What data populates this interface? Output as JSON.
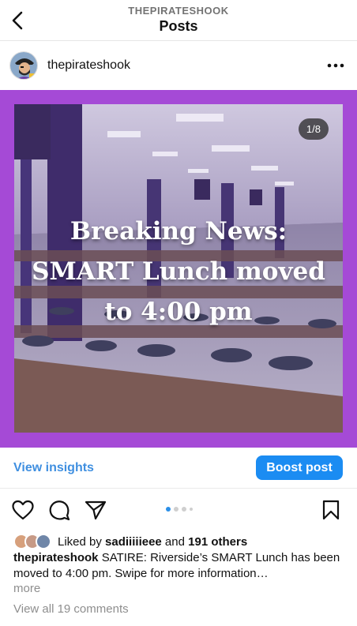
{
  "header": {
    "account": "THEPIRATESHOOK",
    "title": "Posts"
  },
  "post": {
    "username": "thepirateshook",
    "slide_counter": "1/8",
    "headline_lines": [
      "Breaking News:",
      "SMART Lunch moved",
      "to 4:00 pm"
    ],
    "frame_color": "#a54ad6"
  },
  "actions": {
    "insights_label": "View insights",
    "boost_label": "Boost post"
  },
  "carousel": {
    "current": 1,
    "dots_shown": 4
  },
  "likes": {
    "prefix": "Liked by ",
    "user": "sadiiiiieee",
    "middle": " and ",
    "others": "191 others"
  },
  "caption": {
    "username": "thepirateshook",
    "text": " SATIRE: Riverside’s SMART Lunch has been moved to 4:00 pm. Swipe for more information…",
    "more": "more"
  },
  "comments": {
    "view_all": "View all 19 comments"
  },
  "colors": {
    "accent": "#1b8cf2",
    "link": "#3f8fe0",
    "muted": "#8e8e8e"
  }
}
